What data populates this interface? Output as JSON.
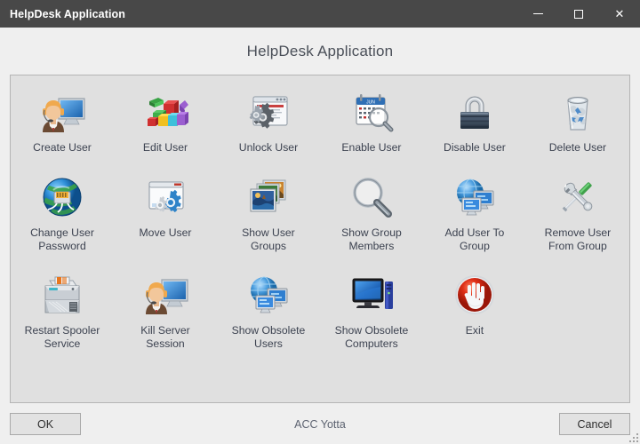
{
  "window": {
    "title": "HelpDesk Application",
    "controls": {
      "minimize": "─",
      "maximize": "□",
      "close": "✕"
    }
  },
  "header": {
    "title": "HelpDesk Application"
  },
  "colors": {
    "titlebar_bg": "#484848",
    "titlebar_fg": "#ffffff",
    "dialog_bg": "#efefef",
    "panel_bg": "#e0e0e0",
    "panel_border": "#b5b5b5",
    "label_fg": "#3c4250",
    "header_fg": "#4a4f58",
    "button_bg": "#e2e2e2",
    "button_border": "#a9a9a9",
    "exit_accent": "#cc2200"
  },
  "panel": {
    "rows": [
      {
        "items": [
          {
            "label": "Create User",
            "icon": "support-agent-monitor-icon"
          },
          {
            "label": "Edit User",
            "icon": "colored-blocks-icon"
          },
          {
            "label": "Unlock User",
            "icon": "window-gears-icon"
          },
          {
            "label": "Enable User",
            "icon": "calendar-magnifier-icon"
          },
          {
            "label": "Disable User",
            "icon": "padlock-icon"
          },
          {
            "label": "Delete User",
            "icon": "recycle-bin-icon"
          }
        ]
      },
      {
        "items": [
          {
            "label": "Change User Password",
            "icon": "globe-network-jack-icon"
          },
          {
            "label": "Move User",
            "icon": "window-settings-gears-icon"
          },
          {
            "label": "Show User Groups",
            "icon": "stacked-photos-icon"
          },
          {
            "label": "Show Group Members",
            "icon": "magnifier-icon"
          },
          {
            "label": "Add User To Group",
            "icon": "globe-two-monitors-icon"
          },
          {
            "label": "Remove User From Group",
            "icon": "screwdriver-wrench-icon"
          }
        ]
      },
      {
        "items": [
          {
            "label": "Restart Spooler Service",
            "icon": "printer-icon"
          },
          {
            "label": "Kill Server Session",
            "icon": "support-agent-monitor-icon"
          },
          {
            "label": "Show Obsolete Users",
            "icon": "globe-two-monitors-icon"
          },
          {
            "label": "Show Obsolete Computers",
            "icon": "desktop-computer-tower-icon"
          },
          {
            "label": "Exit",
            "icon": "red-stop-hand-icon"
          }
        ]
      }
    ]
  },
  "footer": {
    "ok_label": "OK",
    "status_text": "ACC Yotta",
    "cancel_label": "Cancel"
  }
}
